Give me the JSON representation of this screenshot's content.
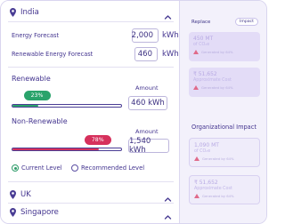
{
  "regions": {
    "india": {
      "name": "India"
    },
    "uk": {
      "name": "UK"
    },
    "singapore": {
      "name": "Singapore"
    }
  },
  "forecast": {
    "energy_label": "Energy Forecast",
    "energy_value": "2,000",
    "energy_unit": "kWh",
    "renewable_label": "Renewable Energy Forecast",
    "renewable_value": "460",
    "renewable_unit": "kWh"
  },
  "renewable": {
    "title": "Renewable",
    "percent": 23,
    "percent_label": "23%",
    "amount_label": "Amount",
    "amount_value": "460 kWh",
    "color": "#2aa36b"
  },
  "non_renewable": {
    "title": "Non-Renewable",
    "percent": 78,
    "percent_label": "78%",
    "amount_label": "Amount",
    "amount_value": "1,540 kWh",
    "color": "#d6305c"
  },
  "levels": {
    "current": "Current Level",
    "recommended": "Recommended Level",
    "selected": "current"
  },
  "side_panel": {
    "title": "Replace",
    "tag": "Impact",
    "cards_top": [
      {
        "main": "450 MT",
        "sub": "of CO₂e",
        "warn": "Generated by 64%"
      },
      {
        "main": "₹ 51,652",
        "sub": "Approximate Cost",
        "warn": "Generated by 64%"
      }
    ],
    "org_heading": "Organizational Impact",
    "cards_bottom": [
      {
        "main": "1,090 MT",
        "sub": "of CO₂e",
        "warn": "Generated by 64%"
      },
      {
        "main": "₹ 51,652",
        "sub": "Approximate Cost",
        "warn": "Generated by 64%"
      }
    ]
  }
}
